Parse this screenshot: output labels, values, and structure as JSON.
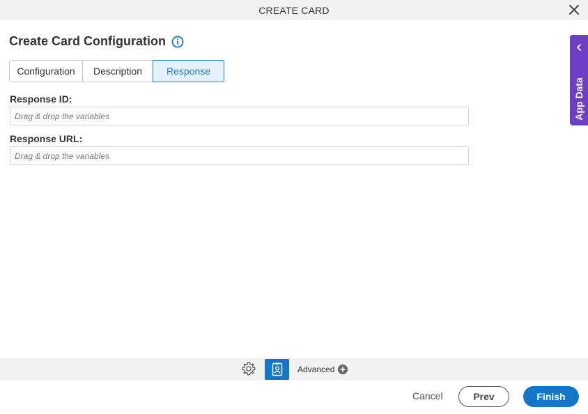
{
  "dialog": {
    "title": "CREATE CARD",
    "close_icon": "close-icon"
  },
  "page": {
    "heading": "Create Card Configuration",
    "info_icon": "info-icon"
  },
  "tabs": [
    {
      "label": "Configuration",
      "active": false
    },
    {
      "label": "Description",
      "active": false
    },
    {
      "label": "Response",
      "active": true
    }
  ],
  "form": {
    "response_id": {
      "label": "Response ID:",
      "value": "",
      "placeholder": "Drag & drop the variables"
    },
    "response_url": {
      "label": "Response URL:",
      "value": "",
      "placeholder": "Drag & drop the variables"
    }
  },
  "side_panel": {
    "label": "App Data",
    "icon": "chevron-left-icon"
  },
  "toolbar": {
    "gear_icon": "gear-icon",
    "card_icon": "contact-card-icon",
    "advanced_label": "Advanced",
    "advanced_icon": "plus-circle-icon"
  },
  "footer": {
    "cancel_label": "Cancel",
    "prev_label": "Prev",
    "finish_label": "Finish"
  },
  "colors": {
    "accent": "#1476c6",
    "tab_active_bg": "#e6f2fb",
    "side_panel": "#6c3fc5",
    "bar_bg": "#f2f2f2"
  }
}
